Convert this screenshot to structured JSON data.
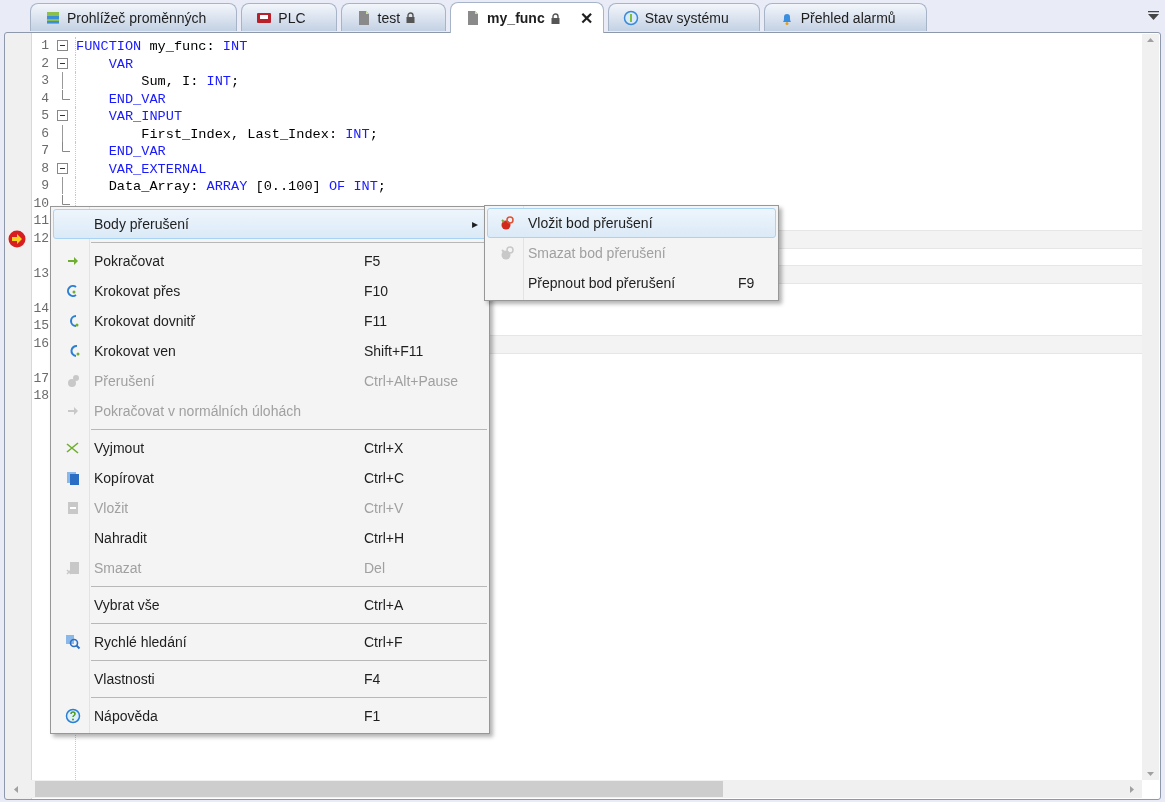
{
  "tabs": [
    {
      "label": "Prohlížeč proměnných",
      "kind": "table",
      "locked": false,
      "closable": false,
      "selected": false
    },
    {
      "label": "PLC",
      "kind": "device",
      "locked": false,
      "closable": false,
      "selected": false
    },
    {
      "label": "test",
      "kind": "document",
      "locked": true,
      "closable": false,
      "selected": false
    },
    {
      "label": "my_func",
      "kind": "document",
      "locked": true,
      "closable": true,
      "close_label": "✕",
      "selected": true
    },
    {
      "label": "Stav systému",
      "kind": "status",
      "locked": false,
      "closable": false,
      "selected": false
    },
    {
      "label": "Přehled alarmů",
      "kind": "bell",
      "locked": false,
      "closable": false,
      "selected": false
    }
  ],
  "editor": {
    "lines": [
      {
        "number": "1",
        "kind": "fold-start",
        "tokens": [
          {
            "text": "FUNCTION",
            "kind": "keyword"
          },
          {
            "text": " my_func: ",
            "kind": "plain"
          },
          {
            "text": "INT",
            "kind": "keyword"
          }
        ]
      },
      {
        "number": "2",
        "kind": "fold-start",
        "tokens": [
          {
            "text": "    VAR",
            "kind": "keyword"
          }
        ]
      },
      {
        "number": "3",
        "kind": "fold-body",
        "tokens": [
          {
            "text": "        Sum, I: ",
            "kind": "plain"
          },
          {
            "text": "INT",
            "kind": "keyword"
          },
          {
            "text": ";",
            "kind": "plain"
          }
        ]
      },
      {
        "number": "4",
        "kind": "fold-end",
        "tokens": [
          {
            "text": "    END_VAR",
            "kind": "keyword"
          }
        ]
      },
      {
        "number": "5",
        "kind": "fold-start",
        "tokens": [
          {
            "text": "    VAR_INPUT",
            "kind": "keyword"
          }
        ]
      },
      {
        "number": "6",
        "kind": "fold-body",
        "tokens": [
          {
            "text": "        First_Index, Last_Index: ",
            "kind": "plain"
          },
          {
            "text": "INT",
            "kind": "keyword"
          },
          {
            "text": ";",
            "kind": "plain"
          }
        ]
      },
      {
        "number": "7",
        "kind": "fold-end",
        "tokens": [
          {
            "text": "    END_VAR",
            "kind": "keyword"
          }
        ]
      },
      {
        "number": "8",
        "kind": "fold-start",
        "tokens": [
          {
            "text": "    VAR_EXTERNAL",
            "kind": "keyword"
          }
        ]
      },
      {
        "number": "9",
        "kind": "fold-body",
        "tokens": [
          {
            "text": "    Data_Array: ",
            "kind": "plain"
          },
          {
            "text": "ARRAY",
            "kind": "keyword"
          },
          {
            "text": " [0..100] ",
            "kind": "plain"
          },
          {
            "text": "OF INT",
            "kind": "keyword"
          },
          {
            "text": ";",
            "kind": "plain"
          }
        ]
      },
      {
        "number": "10",
        "kind": "fold-end"
      },
      {
        "number": "11",
        "kind": "plain"
      },
      {
        "number": "12",
        "kind": "plain",
        "current": true,
        "monitor": true
      },
      {
        "number": "13",
        "kind": "plain",
        "monitor": true
      },
      {
        "number": "14",
        "kind": "plain"
      },
      {
        "number": "15",
        "kind": "plain"
      },
      {
        "number": "16",
        "kind": "plain",
        "monitor": true
      },
      {
        "number": "17",
        "kind": "plain"
      },
      {
        "number": "18",
        "kind": "plain"
      }
    ]
  },
  "context_menu": {
    "items": [
      {
        "kind": "submenu",
        "label": "Body přerušení",
        "arrow": "▸",
        "disabled": false,
        "selected": true
      },
      {
        "kind": "separator"
      },
      {
        "kind": "continue",
        "label": "Pokračovat",
        "shortcut": "F5",
        "disabled": false,
        "selected": false
      },
      {
        "kind": "step-over",
        "label": "Krokovat přes",
        "shortcut": "F10",
        "disabled": false,
        "selected": false
      },
      {
        "kind": "step-into",
        "label": "Krokovat dovnitř",
        "shortcut": "F11",
        "disabled": false,
        "selected": false
      },
      {
        "kind": "step-out",
        "label": "Krokovat ven",
        "shortcut": "Shift+F11",
        "disabled": false,
        "selected": false
      },
      {
        "kind": "pause",
        "label": "Přerušení",
        "shortcut": "Ctrl+Alt+Pause",
        "disabled": true,
        "selected": false
      },
      {
        "kind": "continue",
        "label": "Pokračovat v normálních úlohách",
        "disabled": true,
        "selected": false
      },
      {
        "kind": "separator"
      },
      {
        "kind": "cut",
        "label": "Vyjmout",
        "shortcut": "Ctrl+X",
        "disabled": false,
        "selected": false
      },
      {
        "kind": "copy",
        "label": "Kopírovat",
        "shortcut": "Ctrl+C",
        "disabled": false,
        "selected": false
      },
      {
        "kind": "paste",
        "label": "Vložit",
        "shortcut": "Ctrl+V",
        "disabled": true,
        "selected": false
      },
      {
        "kind": "plain",
        "label": "Nahradit",
        "shortcut": "Ctrl+H",
        "disabled": false,
        "selected": false
      },
      {
        "kind": "delete",
        "label": "Smazat",
        "shortcut": "Del",
        "disabled": true,
        "selected": false
      },
      {
        "kind": "separator"
      },
      {
        "kind": "plain",
        "label": "Vybrat vše",
        "shortcut": "Ctrl+A",
        "disabled": false,
        "selected": false
      },
      {
        "kind": "separator"
      },
      {
        "kind": "search",
        "label": "Rychlé hledání",
        "shortcut": "Ctrl+F",
        "disabled": false,
        "selected": false
      },
      {
        "kind": "separator"
      },
      {
        "kind": "plain",
        "label": "Vlastnosti",
        "shortcut": "F4",
        "disabled": false,
        "selected": false
      },
      {
        "kind": "separator"
      },
      {
        "kind": "help",
        "label": "Nápověda",
        "shortcut": "F1",
        "disabled": false,
        "selected": false
      }
    ]
  },
  "submenu": {
    "items": [
      {
        "kind": "breakpoint",
        "label": "Vložit bod přerušení",
        "disabled": false,
        "selected": true
      },
      {
        "kind": "breakpoint",
        "label": "Smazat bod přerušení",
        "disabled": true,
        "selected": false
      },
      {
        "kind": "plain",
        "label": "Přepnout bod přerušení",
        "shortcut": "F9",
        "disabled": false,
        "selected": false
      }
    ]
  }
}
